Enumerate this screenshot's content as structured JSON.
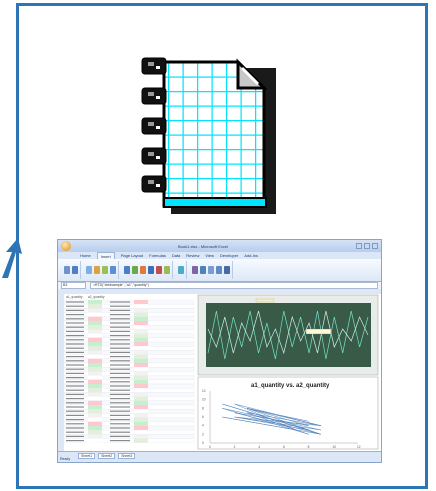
{
  "excel": {
    "window_title": "Book1.xlsx - Microsoft Excel",
    "tabs": [
      "Home",
      "Insert",
      "Page Layout",
      "Formulas",
      "Data",
      "Review",
      "View",
      "Developer",
      "Add-Ins"
    ],
    "name_box": "B3",
    "formula": "=RTD(\"xlrtdsample\",,\"a1\",\"quantity\")",
    "col_headers": [
      "a1_quantity",
      "a2_quantity"
    ],
    "sheet_tabs": [
      "Sheet1",
      "Sheet2",
      "Sheet3"
    ],
    "status": "Ready"
  },
  "chart_data": [
    {
      "type": "line",
      "title": "",
      "series": [
        {
          "name": "a1_quantity",
          "values": [
            2,
            9,
            1,
            8,
            3,
            9,
            2,
            7,
            1,
            9,
            3,
            8,
            2,
            9,
            1,
            8,
            2,
            9,
            3,
            8
          ]
        },
        {
          "name": "a2_quantity",
          "values": [
            6,
            3,
            8,
            2,
            7,
            4,
            9,
            3,
            6,
            2,
            8,
            4,
            7,
            2,
            9,
            3,
            6,
            4,
            8,
            5
          ]
        }
      ]
    },
    {
      "type": "line",
      "title": "a1_quantity vs. a2_quantity",
      "y_ticks": [
        "12",
        "10",
        "8",
        "6",
        "4",
        "2",
        "0"
      ],
      "x_ticks": [
        "0",
        "2",
        "4",
        "6",
        "8",
        "10",
        "12"
      ]
    }
  ],
  "colors": {
    "frame": "#2e75b6",
    "arrow": "#2e75b6",
    "grid_cyan": "#00e5ff",
    "chart_bg": "#3a5a48",
    "chart_line": "#6fe3c8"
  }
}
